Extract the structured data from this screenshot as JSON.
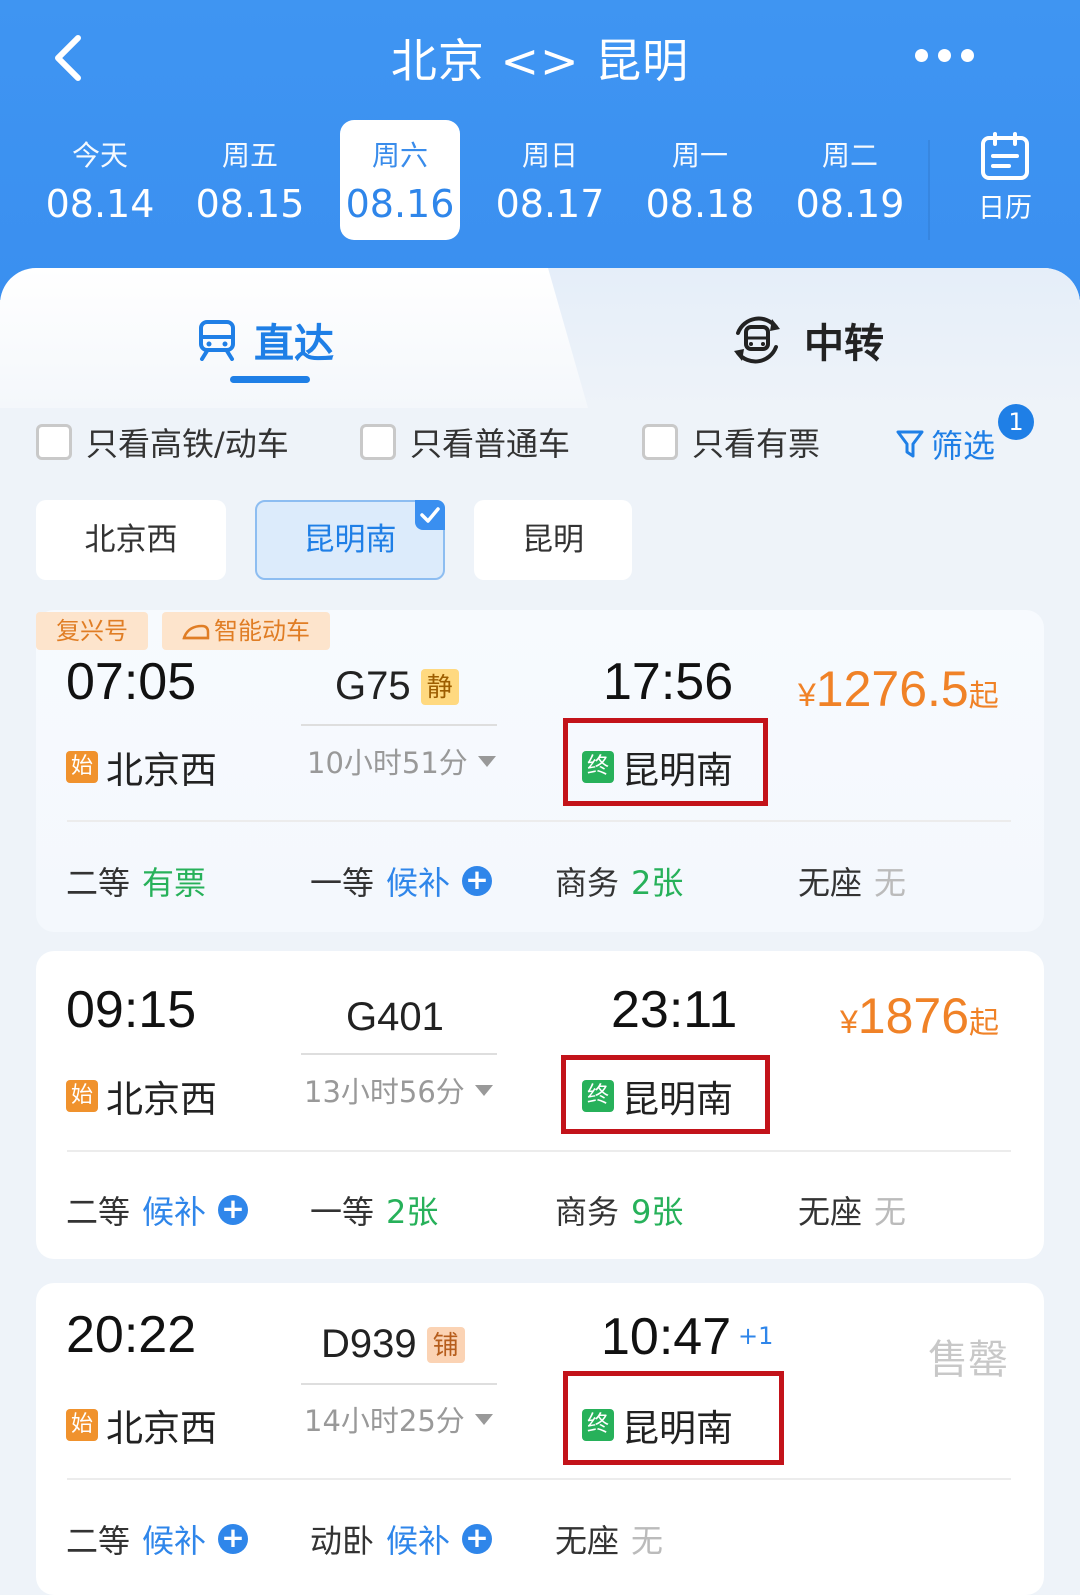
{
  "header": {
    "title": "北京 <> 昆明",
    "calendar_label": "日历"
  },
  "dates": [
    {
      "weekday": "今天",
      "date": "08.14"
    },
    {
      "weekday": "周五",
      "date": "08.15"
    },
    {
      "weekday": "周六",
      "date": "08.16"
    },
    {
      "weekday": "周日",
      "date": "08.17"
    },
    {
      "weekday": "周一",
      "date": "08.18"
    },
    {
      "weekday": "周二",
      "date": "08.19"
    }
  ],
  "tabs": {
    "direct": "直达",
    "transfer": "中转"
  },
  "filters": {
    "high_speed": "只看高铁/动车",
    "regular": "只看普通车",
    "available": "只看有票",
    "filter_label": "筛选",
    "filter_count": "1"
  },
  "stations": [
    "北京西",
    "昆明南",
    "昆明"
  ],
  "badges": {
    "start": "始",
    "end": "终"
  },
  "trains": [
    {
      "tags": [
        "复兴号",
        "智能动车"
      ],
      "dep_time": "07:05",
      "dep_station": "北京西",
      "train_no": "G75",
      "train_tag": "静",
      "duration": "10小时51分",
      "arr_time": "17:56",
      "arr_station": "昆明南",
      "price_currency": "¥",
      "price_amount": "1276.5",
      "price_suffix": "起",
      "seats": [
        {
          "type": "二等",
          "status": "有票"
        },
        {
          "type": "一等",
          "status": "候补"
        },
        {
          "type": "商务",
          "status": "2张"
        },
        {
          "type": "无座",
          "status": "无"
        }
      ]
    },
    {
      "dep_time": "09:15",
      "dep_station": "北京西",
      "train_no": "G401",
      "duration": "13小时56分",
      "arr_time": "23:11",
      "arr_station": "昆明南",
      "price_currency": "¥",
      "price_amount": "1876",
      "price_suffix": "起",
      "seats": [
        {
          "type": "二等",
          "status": "候补"
        },
        {
          "type": "一等",
          "status": "2张"
        },
        {
          "type": "商务",
          "status": "9张"
        },
        {
          "type": "无座",
          "status": "无"
        }
      ]
    },
    {
      "dep_time": "20:22",
      "dep_station": "北京西",
      "train_no": "D939",
      "train_tag": "铺",
      "duration": "14小时25分",
      "arr_time": "10:47",
      "arr_day_offset": "+1",
      "arr_station": "昆明南",
      "price_status": "售罄",
      "seats": [
        {
          "type": "二等",
          "status": "候补"
        },
        {
          "type": "动卧",
          "status": "候补"
        },
        {
          "type": "无座",
          "status": "无"
        }
      ]
    }
  ],
  "colors": {
    "header_blue": "#3a8ff0",
    "accent_blue": "#1f7fe6",
    "price_orange": "#f08227",
    "available_green": "#27b15a",
    "highlight_red": "#c3131a"
  }
}
